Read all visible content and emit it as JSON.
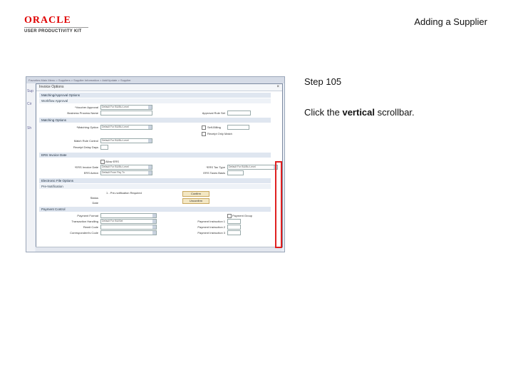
{
  "header": {
    "logo_oracle": "ORACLE",
    "logo_upk": "USER PRODUCTIVITY KIT",
    "page_title": "Adding a Supplier"
  },
  "step": {
    "label": "Step 105",
    "instruction_prefix": "Click the ",
    "instruction_bold": "vertical",
    "instruction_suffix": " scrollbar."
  },
  "screenshot": {
    "nav_text": "Favorites   Main Menu   >   Suppliers   >   Supplier Information   >   Add/Update   >   Supplier",
    "side_labels": [
      "Sup",
      "Cir",
      "Sh"
    ],
    "dialog_title": "Invoice Options",
    "close_glyph": "×",
    "section_matching": "Matching/Approval Options",
    "sub_workflow": "Workflow Approval",
    "field_voucher_approval": "*Voucher Approval",
    "value_voucher_approval": "Default For BU/Bu Level",
    "field_business_process": "Business Process Name",
    "field_approval_rule": "Approval Rule Set",
    "section_match_options": "Matching Options",
    "field_match_option": "*Matching Option",
    "value_match_option": "Default For BU/Bu Level",
    "check_ers": "Self-Billing",
    "check_receipt_only": "Receipt Only Match",
    "field_match_rule": "Match Rule Control",
    "value_match_rule": "Default For BU/Bu Level",
    "field_receipt_days": "Receipt Delay Days",
    "section_ers": "ERS Invoice Date",
    "check_allow_ers": "Allow ERS",
    "field_ers_inv_date": "*ERS Invoice Date",
    "value_ers_inv_date": "Default For BU/Bu Level",
    "field_ers_tax_type": "*ERS Tax Type",
    "value_ers_tax_type": "Default For BU/Bu Level",
    "field_ers_action": "ERS Action",
    "value_ers_action": "Default From Pay Tx",
    "field_ers_tax_basis": "ERS Taxes Basis",
    "section_electronic": "Electronic File Options",
    "sub_pre_notification": "Pre-Notification",
    "field_status": "Status",
    "value_status": "1 - Pre-notification Required",
    "field_date": "Date",
    "button_confirm": "Confirm",
    "button_unconfirm": "Unconfirm",
    "section_payment": "Payment Control",
    "field_payment_format": "Payment Format",
    "check_pay_group": "Payment Group",
    "field_transaction_handling": "Transaction Handling",
    "value_transaction_handling": "Default For BU/Set",
    "field_remit_code": "Remit Code",
    "field_correspondent_code": "Correspondent's Code",
    "field_payment_instruction_1": "Payment Instruction 1",
    "field_payment_instruction_2": "Payment Instruction 2",
    "field_payment_instruction_3": "Payment Instruction 3"
  }
}
